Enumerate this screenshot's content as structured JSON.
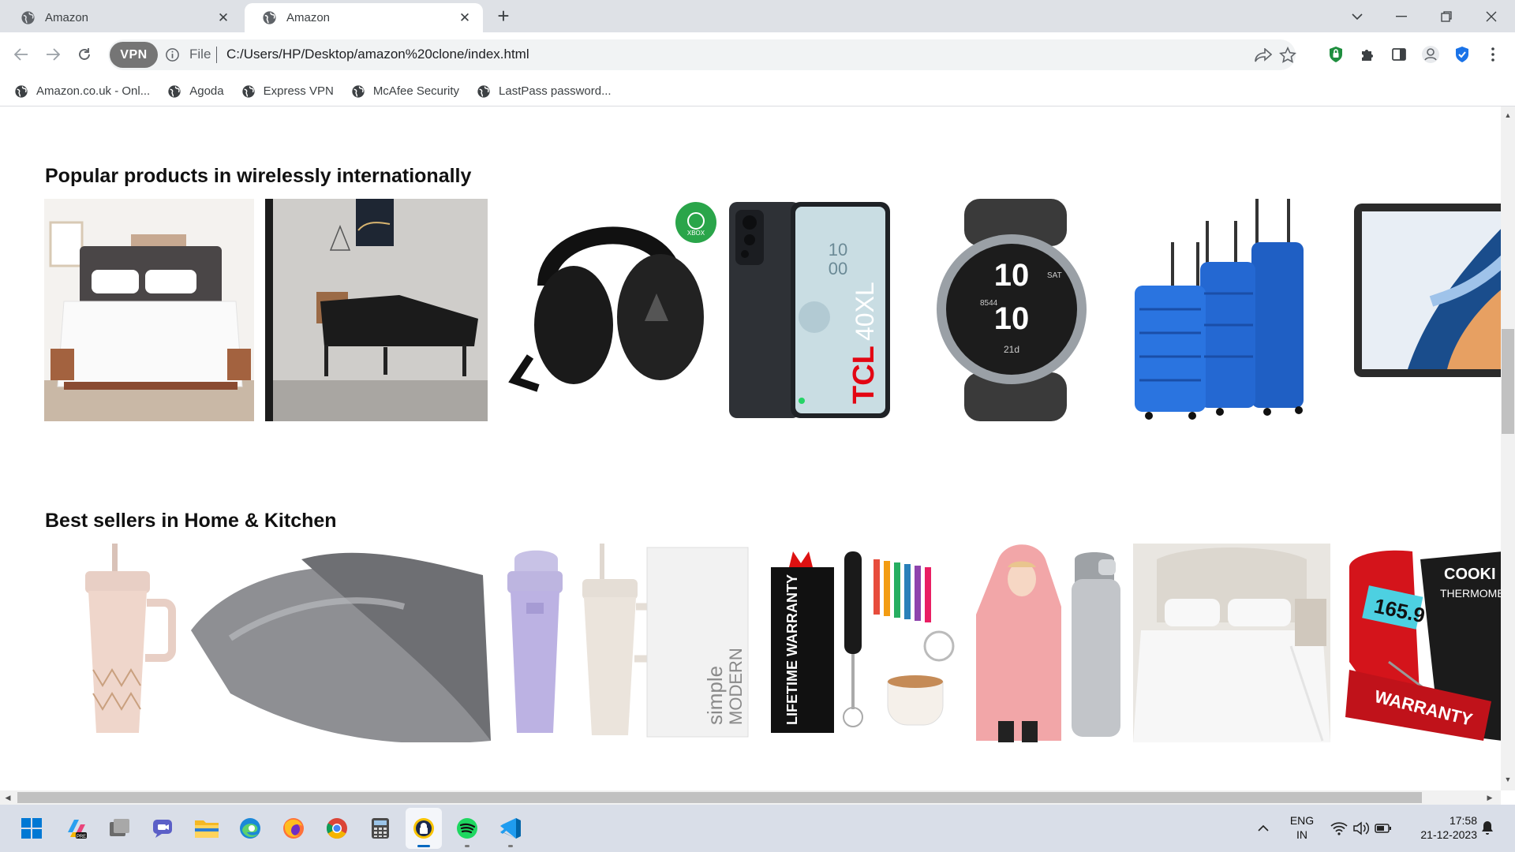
{
  "browser": {
    "tabs": [
      {
        "title": "Amazon",
        "active": false
      },
      {
        "title": "Amazon",
        "active": true
      }
    ],
    "vpn_label": "VPN",
    "url_scheme": "File",
    "url": "C:/Users/HP/Desktop/amazon%20clone/index.html",
    "bookmarks": [
      "Amazon.co.uk - Onl...",
      "Agoda",
      "Express VPN",
      "McAfee Security",
      "LastPass password..."
    ]
  },
  "page": {
    "sections": [
      {
        "title": "Popular products in wirelessly internationally",
        "products": [
          "bed-with-white-bedding",
          "adjustable-bed-base",
          "gaming-headset-black",
          "tcl-40xl-phone",
          "garmin-fenix-watch",
          "blue-luggage-set",
          "samsung-tablet"
        ]
      },
      {
        "title": "Best sellers in Home & Kitchen",
        "products": [
          "stanley-tumbler-pink",
          "satin-pillowcase-grey",
          "stanley-tumbler-lavender",
          "simple-modern-tumbler",
          "milk-frother",
          "wearable-blanket-hoodie",
          "owala-water-bottle",
          "white-bed-sheets",
          "meat-thermometer"
        ]
      }
    ]
  },
  "taskbar": {
    "lang_top": "ENG",
    "lang_bottom": "IN",
    "time": "17:58",
    "date": "21-12-2023"
  },
  "colors": {
    "tabstrip": "#dee1e6",
    "omnibox": "#f1f3f4",
    "taskbar": "#d9dee8",
    "accent": "#0067c0"
  }
}
